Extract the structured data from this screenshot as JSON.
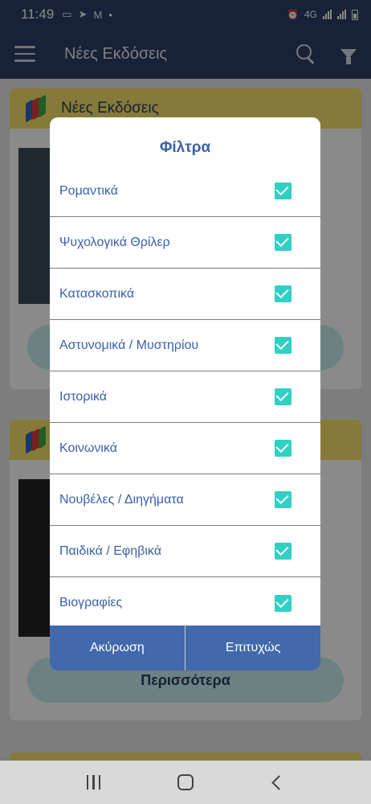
{
  "status_bar": {
    "time": "11:49",
    "icons": [
      "laptop-icon",
      "location-icon",
      "mail-icon",
      "dot-icon",
      "alarm-icon",
      "4g-icon",
      "signal-icon",
      "signal-icon",
      "battery-icon"
    ],
    "network": "4G"
  },
  "app_bar": {
    "title": "Νέες Εκδόσεις",
    "icons": [
      "menu-icon",
      "search-icon",
      "filter-icon"
    ]
  },
  "background": {
    "card_title": "Νέες Εκδόσεις",
    "more_button": "Περισσότερα"
  },
  "dialog": {
    "title": "Φίλτρα",
    "options": [
      {
        "label": "Ρομαντικά",
        "checked": true
      },
      {
        "label": "Ψυχολογικά Θρίλερ",
        "checked": true
      },
      {
        "label": "Κατασκοπικά",
        "checked": true
      },
      {
        "label": "Αστυνομικά / Μυστηρίου",
        "checked": true
      },
      {
        "label": "Ιστορικά",
        "checked": true
      },
      {
        "label": "Κοινωνικά",
        "checked": true
      },
      {
        "label": "Νουβέλες / Διηγήματα",
        "checked": true
      },
      {
        "label": "Παιδικά / Εφηβικά",
        "checked": true
      },
      {
        "label": "Βιογραφίες",
        "checked": true
      }
    ],
    "cancel_label": "Ακύρωση",
    "confirm_label": "Επιτυχώς"
  },
  "colors": {
    "app_bar": "#2b3d66",
    "accent_text": "#3b60a8",
    "checkbox": "#2fd1c4",
    "footer": "#4169ab",
    "card_header": "#f6e16a"
  },
  "nav_bar": {
    "icons": [
      "recents-icon",
      "home-icon",
      "back-icon"
    ]
  }
}
